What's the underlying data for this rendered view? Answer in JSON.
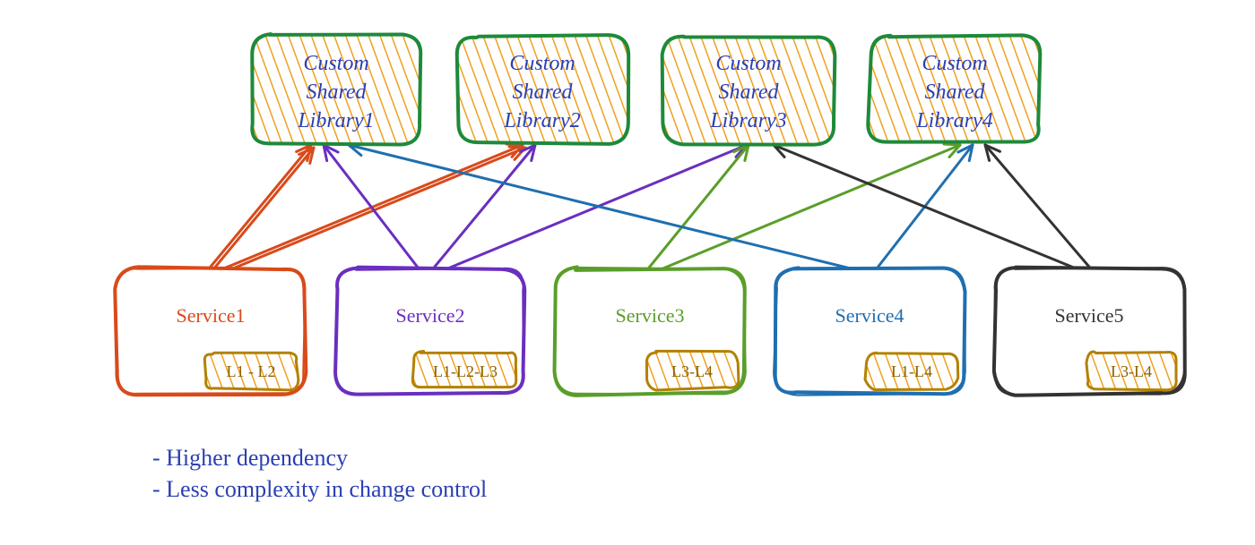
{
  "libraries": [
    {
      "id": "lib1",
      "line1": "Custom",
      "line2": "Shared",
      "line3": "Library1"
    },
    {
      "id": "lib2",
      "line1": "Custom",
      "line2": "Shared",
      "line3": "Library2"
    },
    {
      "id": "lib3",
      "line1": "Custom",
      "line2": "Shared",
      "line3": "Library3"
    },
    {
      "id": "lib4",
      "line1": "Custom",
      "line2": "Shared",
      "line3": "Library4"
    }
  ],
  "services": [
    {
      "id": "svc1",
      "label": "Service1",
      "badge": "L1 - L2",
      "color": "#d94a1a",
      "deps": [
        "lib1",
        "lib2"
      ]
    },
    {
      "id": "svc2",
      "label": "Service2",
      "badge": "L1-L2-L3",
      "color": "#6a2fbf",
      "deps": [
        "lib1",
        "lib2",
        "lib3"
      ]
    },
    {
      "id": "svc3",
      "label": "Service3",
      "badge": "L3-L4",
      "color": "#5a9e2a",
      "deps": [
        "lib3",
        "lib4"
      ]
    },
    {
      "id": "svc4",
      "label": "Service4",
      "badge": "L1-L4",
      "color": "#1f6fb0",
      "deps": [
        "lib1",
        "lib4"
      ]
    },
    {
      "id": "svc5",
      "label": "Service5",
      "badge": "L3-L4",
      "color": "#333333",
      "deps": [
        "lib3",
        "lib4"
      ]
    }
  ],
  "notes": {
    "line1": "- Higher dependency",
    "line2": "- Less complexity in change control"
  },
  "colors": {
    "library_border": "#1e8a3a",
    "hatch": "#f0a020",
    "badge_border": "#b38100"
  }
}
